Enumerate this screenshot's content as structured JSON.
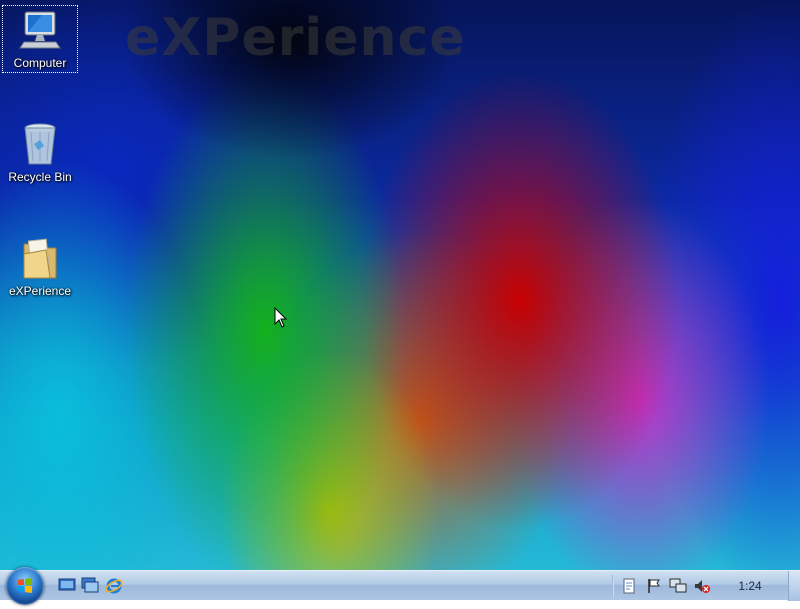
{
  "wallpaper": {
    "brand_text": "eXPerience"
  },
  "desktop_icons": [
    {
      "label": "Computer",
      "icon": "computer-icon",
      "selected": true
    },
    {
      "label": "Recycle Bin",
      "icon": "recycle-bin-icon",
      "selected": false
    },
    {
      "label": "eXPerience",
      "icon": "folder-icon",
      "selected": false
    }
  ],
  "taskbar": {
    "quick_launch": [
      {
        "icon": "show-desktop-icon"
      },
      {
        "icon": "switch-windows-icon"
      },
      {
        "icon": "internet-explorer-icon"
      }
    ],
    "tray": [
      {
        "icon": "document-icon"
      },
      {
        "icon": "action-center-flag-icon"
      },
      {
        "icon": "network-icon"
      },
      {
        "icon": "volume-muted-icon"
      }
    ],
    "clock": "1:24"
  },
  "colors": {
    "taskbar_top": "#cfe0f1",
    "taskbar_bottom": "#aec6e3",
    "start_orb": "#2a78c9"
  }
}
